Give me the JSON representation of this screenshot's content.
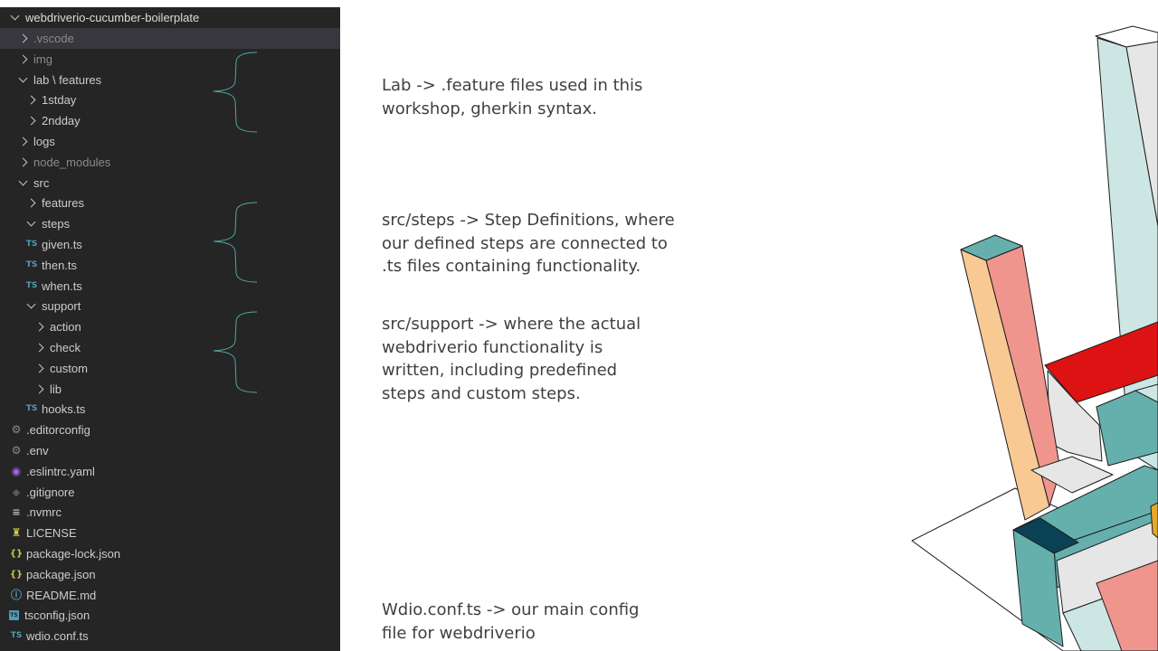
{
  "explorer": {
    "root": "webdriverio-cucumber-boilerplate",
    "items": [
      {
        "label": ".vscode",
        "kind": "folder",
        "open": false,
        "depth": 1,
        "dim": true,
        "selected": true,
        "icon": "chevron-right-icon"
      },
      {
        "label": "img",
        "kind": "folder",
        "open": false,
        "depth": 1,
        "dim": true,
        "icon": "chevron-right-icon"
      },
      {
        "label": "lab \\ features",
        "kind": "folder",
        "open": true,
        "depth": 1,
        "icon": "chevron-down-icon"
      },
      {
        "label": "1stday",
        "kind": "folder",
        "open": false,
        "depth": 2,
        "icon": "chevron-right-icon"
      },
      {
        "label": "2ndday",
        "kind": "folder",
        "open": false,
        "depth": 2,
        "icon": "chevron-right-icon"
      },
      {
        "label": "logs",
        "kind": "folder",
        "open": false,
        "depth": 1,
        "icon": "chevron-right-icon"
      },
      {
        "label": "node_modules",
        "kind": "folder",
        "open": false,
        "depth": 1,
        "dim": true,
        "icon": "chevron-right-icon"
      },
      {
        "label": "src",
        "kind": "folder",
        "open": true,
        "depth": 1,
        "icon": "chevron-down-icon"
      },
      {
        "label": "features",
        "kind": "folder",
        "open": false,
        "depth": 2,
        "icon": "chevron-right-icon"
      },
      {
        "label": "steps",
        "kind": "folder",
        "open": true,
        "depth": 2,
        "icon": "chevron-down-icon"
      },
      {
        "label": "given.ts",
        "kind": "file",
        "depth": 3,
        "icon": "typescript-icon",
        "glyph": "TS"
      },
      {
        "label": "then.ts",
        "kind": "file",
        "depth": 3,
        "icon": "typescript-icon",
        "glyph": "TS"
      },
      {
        "label": "when.ts",
        "kind": "file",
        "depth": 3,
        "icon": "typescript-icon",
        "glyph": "TS"
      },
      {
        "label": "support",
        "kind": "folder",
        "open": true,
        "depth": 2,
        "icon": "chevron-down-icon"
      },
      {
        "label": "action",
        "kind": "folder",
        "open": false,
        "depth": 3,
        "icon": "chevron-right-icon"
      },
      {
        "label": "check",
        "kind": "folder",
        "open": false,
        "depth": 3,
        "icon": "chevron-right-icon"
      },
      {
        "label": "custom",
        "kind": "folder",
        "open": false,
        "depth": 3,
        "icon": "chevron-right-icon"
      },
      {
        "label": "lib",
        "kind": "folder",
        "open": false,
        "depth": 3,
        "icon": "chevron-right-icon"
      },
      {
        "label": "hooks.ts",
        "kind": "file",
        "depth": 3,
        "icon": "typescript-icon",
        "glyph": "TS"
      },
      {
        "label": ".editorconfig",
        "kind": "file",
        "depth": 0,
        "icon": "gear-icon",
        "glyph": "⚙"
      },
      {
        "label": ".env",
        "kind": "file",
        "depth": 0,
        "icon": "gear-icon",
        "glyph": "⚙"
      },
      {
        "label": ".eslintrc.yaml",
        "kind": "file",
        "depth": 0,
        "icon": "eslint-icon",
        "glyph": "◉"
      },
      {
        "label": ".gitignore",
        "kind": "file",
        "depth": 0,
        "icon": "git-icon",
        "glyph": "◆"
      },
      {
        "label": ".nvmrc",
        "kind": "file",
        "depth": 0,
        "icon": "lines-icon",
        "glyph": "≡"
      },
      {
        "label": "LICENSE",
        "kind": "file",
        "depth": 0,
        "icon": "license-icon",
        "glyph": "♜"
      },
      {
        "label": "package-lock.json",
        "kind": "file",
        "depth": 0,
        "icon": "json-icon",
        "glyph": "{}"
      },
      {
        "label": "package.json",
        "kind": "file",
        "depth": 0,
        "icon": "json-icon",
        "glyph": "{}"
      },
      {
        "label": "README.md",
        "kind": "file",
        "depth": 0,
        "icon": "info-icon",
        "glyph": "ⓘ"
      },
      {
        "label": "tsconfig.json",
        "kind": "file",
        "depth": 0,
        "icon": "tsconfig-icon",
        "glyph": "TS"
      },
      {
        "label": "wdio.conf.ts",
        "kind": "file",
        "depth": 0,
        "icon": "typescript-icon",
        "glyph": "TS"
      }
    ]
  },
  "notes": {
    "lab": "Lab -> .feature files used in this\nworkshop, gherkin syntax.",
    "steps": "src/steps -> Step Definitions, where\nour defined steps are connected to\n.ts files containing functionality.",
    "support": "src/support -> where the actual\nwebdriverio functionality is\nwritten, including predefined\nsteps and custom steps.",
    "wdio": "Wdio.conf.ts -> our main config\nfile for webdriverio"
  },
  "colors": {
    "explorer_bg": "#252526",
    "selected_row": "#37373d",
    "bracket": "#4fa9a1",
    "teal": "#65b0ad",
    "light_teal": "#cce6e4",
    "salmon": "#f0958d",
    "peach": "#f8c993",
    "red": "#dd1313",
    "grey": "#e6e6e6",
    "navy": "#0b4155",
    "gold": "#e6a82a"
  }
}
